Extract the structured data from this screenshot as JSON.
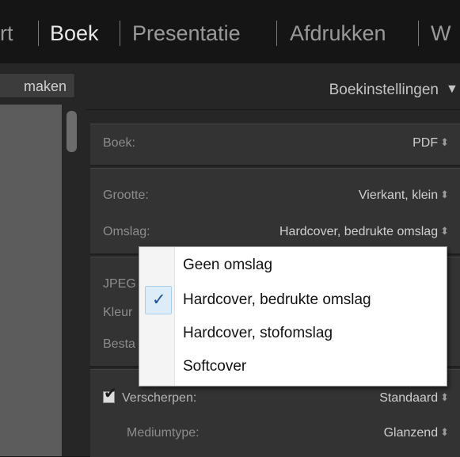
{
  "module_tabs": [
    {
      "label": "rt",
      "active": false
    },
    {
      "label": "Boek",
      "active": true
    },
    {
      "label": "Presentatie",
      "active": false
    },
    {
      "label": "Afdrukken",
      "active": false
    },
    {
      "label": "W",
      "active": false
    }
  ],
  "left_panel": {
    "make_button_label": "maken"
  },
  "book_settings": {
    "header_title": "Boekinstellingen",
    "header_icon": "triangle-down-icon",
    "book": {
      "label": "Boek:",
      "value": "PDF"
    },
    "size": {
      "label": "Grootte:",
      "value": "Vierkant, klein"
    },
    "cover": {
      "label": "Omslag:",
      "value": "Hardcover, bedrukte omslag"
    },
    "jpeg_label": "JPEG",
    "color_label": "Kleur",
    "file_label": "Besta",
    "sharpen": {
      "label": "Verscherpen:",
      "value": "Standaard",
      "checked": true
    },
    "media_type": {
      "label": "Mediumtype:",
      "value": "Glanzend"
    }
  },
  "cover_menu": {
    "items": [
      {
        "label": "Geen omslag",
        "checked": false
      },
      {
        "label": "Hardcover, bedrukte omslag",
        "checked": true
      },
      {
        "label": "Hardcover, stofomslag",
        "checked": false
      },
      {
        "label": "Softcover",
        "checked": false
      }
    ],
    "check_glyph": "✓"
  },
  "spinner_glyph": "⬍",
  "colors": {
    "panel_bg": "#262626",
    "section_bg": "#333333",
    "active_tab": "#e8e8e8",
    "inactive_tab": "#9a9a9a",
    "menu_check_bg": "#dcecf8"
  }
}
